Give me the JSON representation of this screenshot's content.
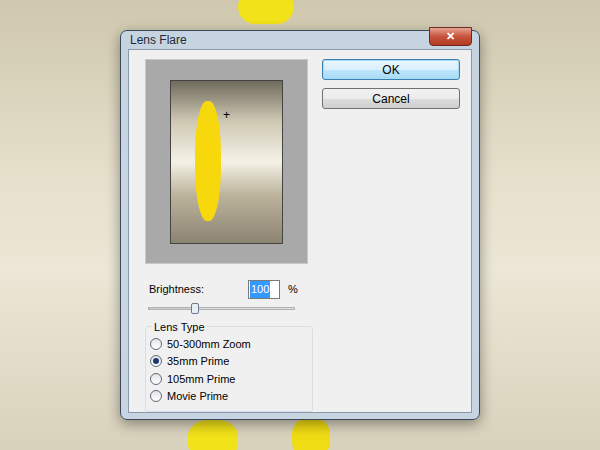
{
  "window": {
    "title": "Lens Flare",
    "close": "✕"
  },
  "buttons": [
    {
      "label": "OK",
      "selected": true
    },
    {
      "label": "Cancel",
      "selected": false
    }
  ],
  "preview": {
    "marker": "+"
  },
  "brightness": {
    "label": "Brightness:",
    "value": "100",
    "unit": "%",
    "level": 0.32
  },
  "lens_type": {
    "legend": "Lens Type",
    "options": [
      {
        "label": "50-300mm Zoom",
        "selected": false
      },
      {
        "label": "35mm Prime",
        "selected": true
      },
      {
        "label": "105mm Prime",
        "selected": false
      },
      {
        "label": "Movie Prime",
        "selected": false
      }
    ]
  }
}
